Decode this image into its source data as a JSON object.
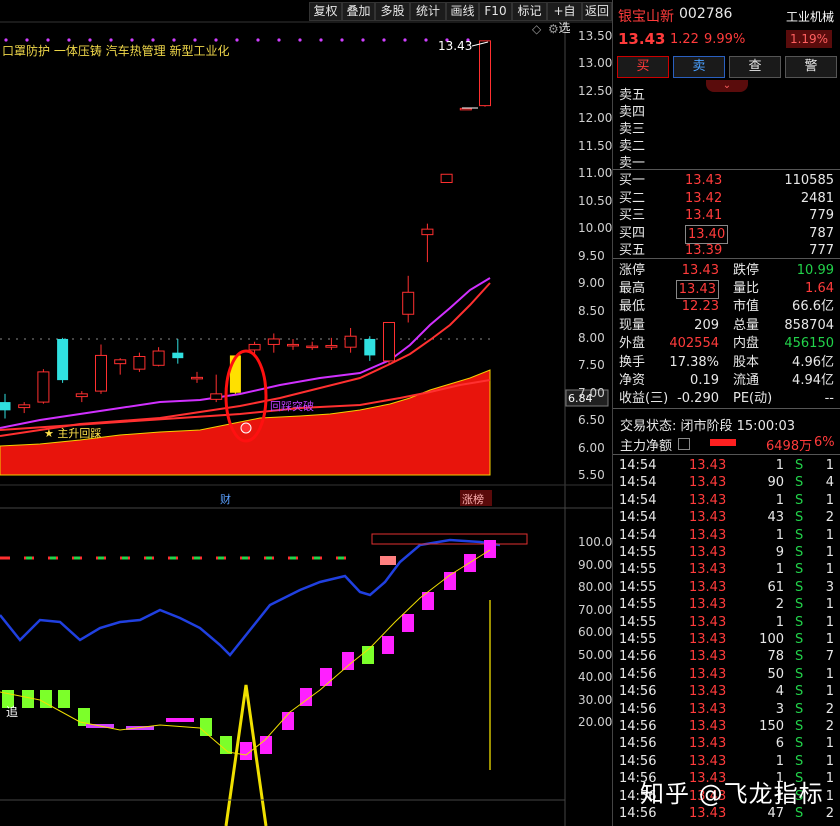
{
  "toolbar": [
    {
      "id": "fuquan",
      "label": "复权"
    },
    {
      "id": "diejia",
      "label": "叠加"
    },
    {
      "id": "duogu",
      "label": "多股"
    },
    {
      "id": "tongji",
      "label": "统计"
    },
    {
      "id": "huaxian",
      "label": "画线"
    },
    {
      "id": "f10",
      "label": "F10"
    },
    {
      "id": "biaoji",
      "label": "标记"
    },
    {
      "id": "zixuan",
      "label": "+自选"
    },
    {
      "id": "fanhui",
      "label": "返回"
    }
  ],
  "concepts": "口罩防护  一体压铸  汽车热管理  新型工业化",
  "chart_labels": {
    "high_label": "13.43",
    "star_label": "★ 主升回踩",
    "breakout_label": "回踩突破",
    "cai_label": "财",
    "zhangbang_label": "涨榜",
    "zhui_label": "追",
    "price_tag": "6.84"
  },
  "stock": {
    "name": "银宝山新",
    "code": "002786",
    "price": "13.43",
    "change": "1.22",
    "change_pct": "9.99%",
    "industry": "工业机械",
    "industry_pct": "1.19%"
  },
  "trade_buttons": {
    "buy": "买",
    "sell": "卖",
    "query": "查",
    "alert": "警"
  },
  "sell_levels": [
    "卖五",
    "卖四",
    "卖三",
    "卖二",
    "卖一"
  ],
  "buy_levels": [
    {
      "label": "买一",
      "price": "13.43",
      "vol": "110585"
    },
    {
      "label": "买二",
      "price": "13.42",
      "vol": "2481"
    },
    {
      "label": "买三",
      "price": "13.41",
      "vol": "779"
    },
    {
      "label": "买四",
      "price": "13.40",
      "vol": "787"
    },
    {
      "label": "买五",
      "price": "13.39",
      "vol": "777"
    }
  ],
  "stats": [
    {
      "l1": "涨停",
      "v1": "13.43",
      "l2": "跌停",
      "v2": "10.99"
    },
    {
      "l1": "最高",
      "v1": "13.43",
      "l2": "量比",
      "v2": "1.64"
    },
    {
      "l1": "最低",
      "v1": "12.23",
      "l2": "市值",
      "v2": "66.6亿"
    },
    {
      "l1": "现量",
      "v1": "209",
      "l2": "总量",
      "v2": "858704"
    },
    {
      "l1": "外盘",
      "v1": "402554",
      "l2": "内盘",
      "v2": "456150"
    },
    {
      "l1": "换手",
      "v1": "17.38%",
      "l2": "股本",
      "v2": "4.96亿"
    },
    {
      "l1": "净资",
      "v1": "0.19",
      "l2": "流通",
      "v2": "4.94亿"
    },
    {
      "l1": "收益(三)",
      "v1": "-0.290",
      "l2": "PE(动)",
      "v2": "--"
    }
  ],
  "trade_status": "交易状态: 闭市阶段 15:00:03",
  "main_flow": {
    "label": "主力净额",
    "amount": "6498万",
    "pct": "6%"
  },
  "ticks": [
    {
      "t": "14:54",
      "p": "13.43",
      "v": "1",
      "s": "S",
      "n": "1"
    },
    {
      "t": "14:54",
      "p": "13.43",
      "v": "90",
      "s": "S",
      "n": "4"
    },
    {
      "t": "14:54",
      "p": "13.43",
      "v": "1",
      "s": "S",
      "n": "1"
    },
    {
      "t": "14:54",
      "p": "13.43",
      "v": "43",
      "s": "S",
      "n": "2"
    },
    {
      "t": "14:54",
      "p": "13.43",
      "v": "1",
      "s": "S",
      "n": "1"
    },
    {
      "t": "14:55",
      "p": "13.43",
      "v": "9",
      "s": "S",
      "n": "1"
    },
    {
      "t": "14:55",
      "p": "13.43",
      "v": "1",
      "s": "S",
      "n": "1"
    },
    {
      "t": "14:55",
      "p": "13.43",
      "v": "61",
      "s": "S",
      "n": "3"
    },
    {
      "t": "14:55",
      "p": "13.43",
      "v": "2",
      "s": "S",
      "n": "1"
    },
    {
      "t": "14:55",
      "p": "13.43",
      "v": "1",
      "s": "S",
      "n": "1"
    },
    {
      "t": "14:55",
      "p": "13.43",
      "v": "100",
      "s": "S",
      "n": "1"
    },
    {
      "t": "14:56",
      "p": "13.43",
      "v": "78",
      "s": "S",
      "n": "7"
    },
    {
      "t": "14:56",
      "p": "13.43",
      "v": "50",
      "s": "S",
      "n": "1"
    },
    {
      "t": "14:56",
      "p": "13.43",
      "v": "4",
      "s": "S",
      "n": "1"
    },
    {
      "t": "14:56",
      "p": "13.43",
      "v": "3",
      "s": "S",
      "n": "2"
    },
    {
      "t": "14:56",
      "p": "13.43",
      "v": "150",
      "s": "S",
      "n": "2"
    },
    {
      "t": "14:56",
      "p": "13.43",
      "v": "6",
      "s": "S",
      "n": "1"
    },
    {
      "t": "14:56",
      "p": "13.43",
      "v": "1",
      "s": "S",
      "n": "1"
    },
    {
      "t": "14:56",
      "p": "13.43",
      "v": "1",
      "s": "S",
      "n": "1"
    },
    {
      "t": "14:56",
      "p": "13.43",
      "v": "1",
      "s": "S",
      "n": "1"
    },
    {
      "t": "14:56",
      "p": "13.43",
      "v": "47",
      "s": "S",
      "n": "2"
    }
  ],
  "watermark": "知乎 @飞龙指标",
  "chart_data": {
    "type": "candlestick",
    "price_axis": [
      13.5,
      13.0,
      12.5,
      12.0,
      11.5,
      11.0,
      10.5,
      10.0,
      9.5,
      9.0,
      8.5,
      8.0,
      7.5,
      7.0,
      6.5,
      6.0,
      5.5
    ],
    "indicator_axis": [
      100.0,
      90.0,
      80.0,
      70.0,
      60.0,
      50.0,
      40.0,
      30.0,
      20.0
    ],
    "candles": [
      {
        "o": 6.85,
        "h": 7.0,
        "l": 6.55,
        "c": 6.7
      },
      {
        "o": 6.75,
        "h": 6.85,
        "l": 6.65,
        "c": 6.8
      },
      {
        "o": 6.85,
        "h": 7.45,
        "l": 6.82,
        "c": 7.4
      },
      {
        "o": 8.0,
        "h": 8.02,
        "l": 7.2,
        "c": 7.25
      },
      {
        "o": 6.95,
        "h": 7.05,
        "l": 6.85,
        "c": 7.0
      },
      {
        "o": 7.05,
        "h": 7.9,
        "l": 7.0,
        "c": 7.7
      },
      {
        "o": 7.55,
        "h": 7.65,
        "l": 7.35,
        "c": 7.62
      },
      {
        "o": 7.45,
        "h": 7.75,
        "l": 7.4,
        "c": 7.68
      },
      {
        "o": 7.52,
        "h": 7.85,
        "l": 7.5,
        "c": 7.78
      },
      {
        "o": 7.75,
        "h": 8.0,
        "l": 7.55,
        "c": 7.65
      },
      {
        "o": 7.3,
        "h": 7.4,
        "l": 7.2,
        "c": 7.3
      },
      {
        "o": 6.9,
        "h": 7.35,
        "l": 6.85,
        "c": 7.0
      },
      {
        "o": 7.02,
        "h": 7.7,
        "l": 7.0,
        "c": 7.7
      },
      {
        "o": 7.8,
        "h": 7.95,
        "l": 7.7,
        "c": 7.9
      },
      {
        "o": 7.9,
        "h": 8.1,
        "l": 7.75,
        "c": 8.0
      },
      {
        "o": 7.88,
        "h": 8.0,
        "l": 7.8,
        "c": 7.9
      },
      {
        "o": 7.85,
        "h": 7.95,
        "l": 7.8,
        "c": 7.87
      },
      {
        "o": 7.85,
        "h": 8.02,
        "l": 7.8,
        "c": 7.88
      },
      {
        "o": 7.85,
        "h": 8.2,
        "l": 7.75,
        "c": 8.05
      },
      {
        "o": 8.0,
        "h": 8.05,
        "l": 7.6,
        "c": 7.7
      },
      {
        "o": 7.6,
        "h": 8.3,
        "l": 7.55,
        "c": 8.3
      },
      {
        "o": 8.45,
        "h": 9.15,
        "l": 8.3,
        "c": 8.85
      },
      {
        "o": 9.9,
        "h": 10.1,
        "l": 9.4,
        "c": 10.0
      },
      {
        "o": 10.85,
        "h": 11.0,
        "l": 10.85,
        "c": 11.0
      },
      {
        "o": 12.2,
        "h": 12.2,
        "l": 12.2,
        "c": 12.2
      },
      {
        "o": 12.25,
        "h": 13.43,
        "l": 12.23,
        "c": 13.43
      }
    ],
    "dashed_level": 8.0
  }
}
